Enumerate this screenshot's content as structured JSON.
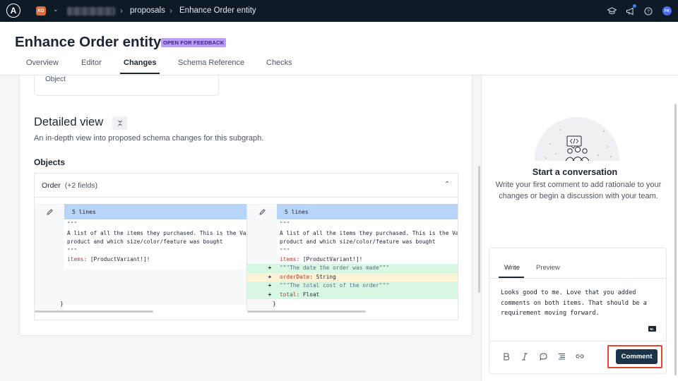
{
  "topbar": {
    "org_initials": "KO",
    "breadcrumb": [
      "proposals",
      "Enhance Order entity"
    ],
    "user_initials": "FK",
    "icons": [
      "apollo-logo-icon",
      "chevron-down-icon",
      "graduation-cap-icon",
      "megaphone-icon",
      "help-icon"
    ]
  },
  "header": {
    "title": "Enhance Order entity",
    "status": "OPEN FOR FEEDBACK",
    "tabs": [
      "Overview",
      "Editor",
      "Changes",
      "Schema Reference",
      "Checks"
    ],
    "active_tab": "Changes"
  },
  "main": {
    "partial_card_text": "Object",
    "section_title": "Detailed view",
    "section_desc": "An in-depth view into proposed schema changes for this subgraph.",
    "objects_label": "Objects",
    "diff": {
      "type_name": "Order",
      "fields_summary": "(+2 fields)",
      "left_hunk_label": "5 lines",
      "right_hunk_label": "5 lines",
      "left_lines": [
        {
          "text": "\"\"\"",
          "kind": "str"
        },
        {
          "text": "A list of all the items they purchased. This is the Va",
          "kind": "plain"
        },
        {
          "text": "product and which size/color/feature was bought",
          "kind": "plain"
        },
        {
          "text": "\"\"\"",
          "kind": "str"
        },
        {
          "key": "items:",
          "val": " [ProductVariant!]!",
          "kind": "field"
        }
      ],
      "right_lines": [
        {
          "text": "\"\"\"",
          "kind": "str"
        },
        {
          "text": "A list of all the items they purchased. This is the Va",
          "kind": "plain"
        },
        {
          "text": "product and which size/color/feature was bought",
          "kind": "plain"
        },
        {
          "text": "\"\"\"",
          "kind": "str"
        },
        {
          "key": "items:",
          "val": " [ProductVariant!]!",
          "kind": "field"
        }
      ],
      "added_lines": [
        {
          "mark": "+",
          "text": "\"\"\"The date the order was made\"\"\"",
          "kind": "str",
          "bg": "add"
        },
        {
          "mark": "+",
          "key": "orderDate:",
          "val": " String",
          "kind": "field",
          "bg": "chg"
        },
        {
          "mark": "+",
          "text": "\"\"\"The total cost of the order\"\"\"",
          "kind": "str",
          "bg": "add"
        },
        {
          "mark": "+",
          "key": "total:",
          "val": " Float",
          "kind": "field",
          "bg": "add"
        }
      ],
      "closing": "}"
    }
  },
  "side": {
    "conv_title": "Start a conversation",
    "conv_desc": "Write your first comment to add rationale to your changes or begin a discussion with your team.",
    "composer": {
      "tabs": [
        "Write",
        "Preview"
      ],
      "text": "Looks good to me. Love that you added comments on both items. That should be a requirement moving forward.",
      "md_badge": "M↓",
      "submit_label": "Comment"
    }
  },
  "colors": {
    "topbar": "#0f1a27",
    "status_badge": "#b89ef5",
    "hunk_header": "#b8d4f8",
    "added_line": "#d8f7e3",
    "changed_line": "#fbf3d6",
    "comment_button": "#1c3448",
    "highlight": "#e8432f"
  }
}
